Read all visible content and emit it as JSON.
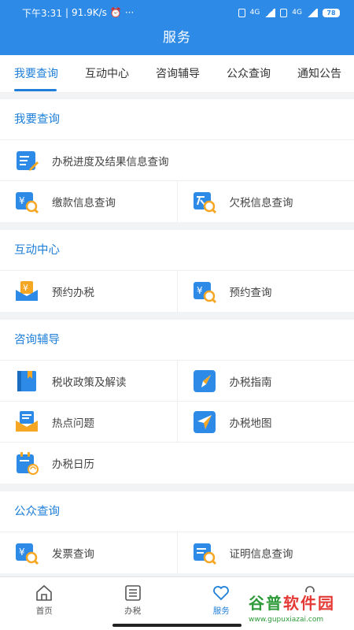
{
  "status": {
    "time": "下午3:31",
    "speed": "91.9K/s",
    "dots": "···",
    "net1": "4G",
    "net2": "4G",
    "battery": "78"
  },
  "header": {
    "title": "服务"
  },
  "tabs": [
    {
      "label": "我要查询"
    },
    {
      "label": "互动中心"
    },
    {
      "label": "咨询辅导"
    },
    {
      "label": "公众查询"
    },
    {
      "label": "通知公告"
    }
  ],
  "sections": {
    "query": {
      "title": "我要查询",
      "items": [
        "办税进度及结果信息查询",
        "缴款信息查询",
        "欠税信息查询"
      ]
    },
    "interact": {
      "title": "互动中心",
      "items": [
        "预约办税",
        "预约查询"
      ]
    },
    "consult": {
      "title": "咨询辅导",
      "items": [
        "税收政策及解读",
        "办税指南",
        "热点问题",
        "办税地图",
        "办税日历"
      ]
    },
    "public": {
      "title": "公众查询",
      "items": [
        "发票查询",
        "证明信息查询"
      ]
    }
  },
  "bottom_nav": [
    {
      "label": "首页"
    },
    {
      "label": "办税"
    },
    {
      "label": "服务"
    },
    {
      "label": ""
    }
  ],
  "watermark": {
    "brand_a": "谷普",
    "brand_b": "软件园",
    "url": "www.gupuxiazai.com"
  },
  "colors": {
    "primary": "#2d8ae6",
    "accent_text": "#1e7fd9",
    "icon_orange": "#f5a623"
  }
}
